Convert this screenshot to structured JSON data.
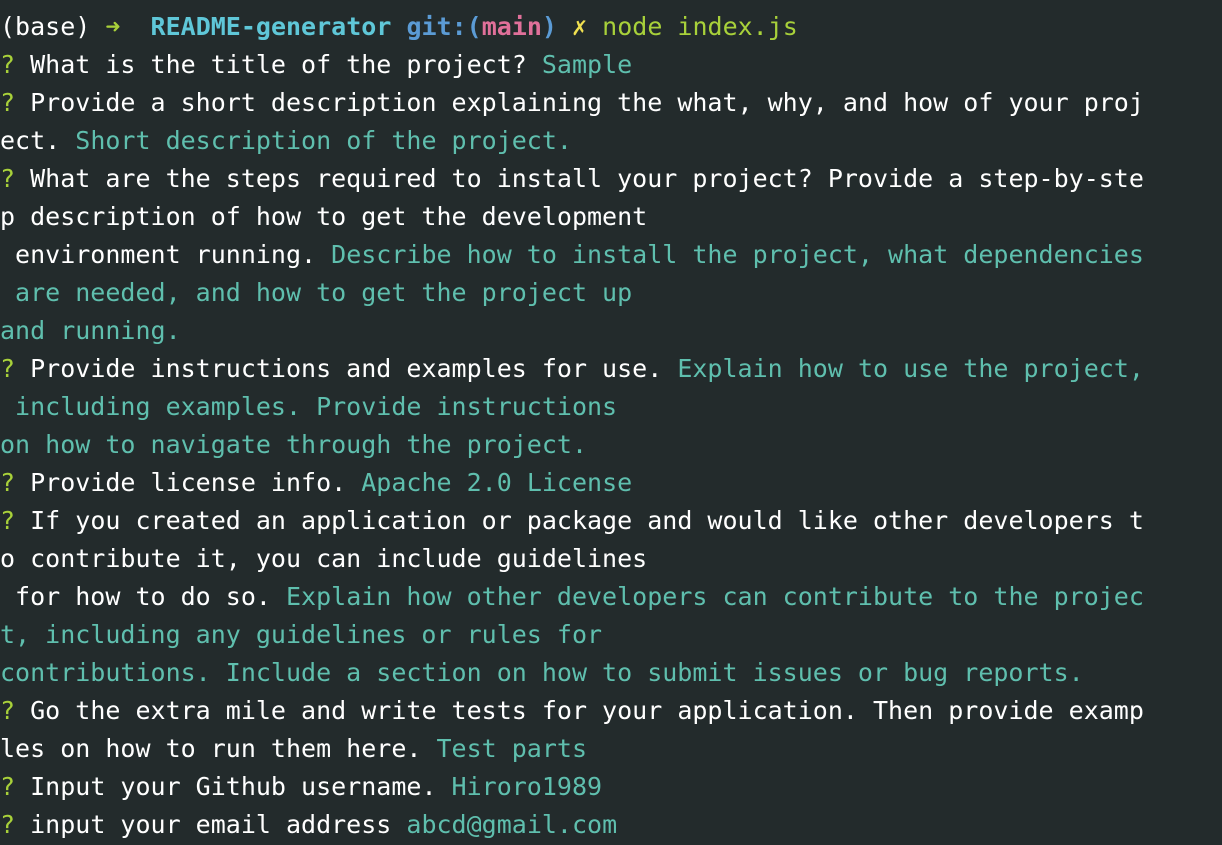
{
  "prompt": {
    "env": "(base)",
    "arrow": "➜",
    "directory": "README-generator",
    "git_label": "git:(",
    "branch": "main",
    "git_close": ")",
    "dirty_mark": "✗",
    "command": "node index.js"
  },
  "lines": [
    {
      "q": "? ",
      "text": "What is the title of the project? ",
      "answer": "Sample"
    },
    {
      "q": "? ",
      "text": "Provide a short description explaining the what, why, and how of your proj",
      "answer": ""
    },
    {
      "q": "",
      "text": "ect. ",
      "answer": "Short description of the project."
    },
    {
      "q": "? ",
      "text": "What are the steps required to install your project? Provide a step-by-ste",
      "answer": ""
    },
    {
      "q": "",
      "text": "p description of how to get the development",
      "answer": ""
    },
    {
      "q": "",
      "text": " environment running. ",
      "answer": "Describe how to install the project, what dependencies"
    },
    {
      "q": "",
      "text": "",
      "answer": " are needed, and how to get the project up"
    },
    {
      "q": "",
      "text": "",
      "answer": "and running."
    },
    {
      "q": "? ",
      "text": "Provide instructions and examples for use. ",
      "answer": "Explain how to use the project,"
    },
    {
      "q": "",
      "text": "",
      "answer": " including examples. Provide instructions"
    },
    {
      "q": "",
      "text": "",
      "answer": "on how to navigate through the project."
    },
    {
      "q": "? ",
      "text": "Provide license info. ",
      "answer": "Apache 2.0 License"
    },
    {
      "q": "? ",
      "text": "If you created an application or package and would like other developers t",
      "answer": ""
    },
    {
      "q": "",
      "text": "o contribute it, you can include guidelines",
      "answer": ""
    },
    {
      "q": "",
      "text": " for how to do so. ",
      "answer": "Explain how other developers can contribute to the projec"
    },
    {
      "q": "",
      "text": "",
      "answer": "t, including any guidelines or rules for"
    },
    {
      "q": "",
      "text": "",
      "answer": "contributions. Include a section on how to submit issues or bug reports."
    },
    {
      "q": "? ",
      "text": "Go the extra mile and write tests for your application. Then provide examp",
      "answer": ""
    },
    {
      "q": "",
      "text": "les on how to run them here. ",
      "answer": "Test parts"
    },
    {
      "q": "? ",
      "text": "Input your Github username. ",
      "answer": "Hiroro1989"
    },
    {
      "q": "? ",
      "text": "input your email address ",
      "answer": "abcd@gmail.com"
    }
  ]
}
